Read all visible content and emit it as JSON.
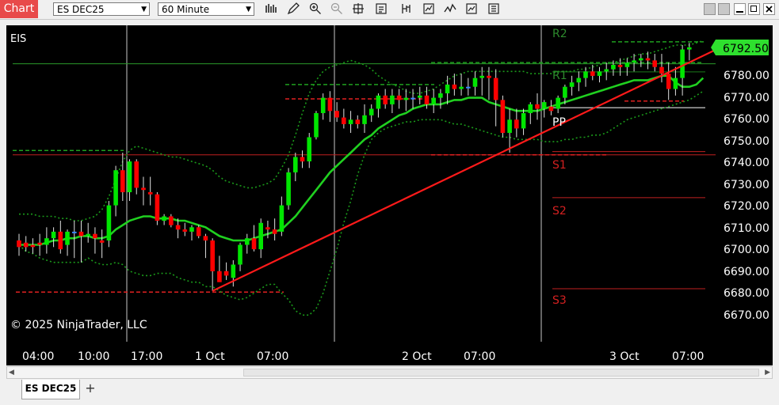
{
  "toolbar": {
    "chart_label": "Chart",
    "instrument": "ES DEC25",
    "interval": "60 Minute",
    "icons": [
      "bars-icon",
      "pencil-icon",
      "zoom-in-icon",
      "zoom-out-icon",
      "crosshair-icon",
      "properties-icon",
      "data-box-icon",
      "strategies-icon",
      "indicators-icon",
      "templates-icon",
      "share-icon"
    ]
  },
  "chart": {
    "symbol": "EIS",
    "copyright": "© 2025 NinjaTrader, LLC",
    "last_price_label": "6792.50",
    "colors": {
      "background": "#000000",
      "up": "#00e600",
      "down": "#ff0000",
      "doji": "#3a86ff",
      "ema": "#20d020",
      "bands": "#1a9a1a",
      "trendline": "#ff1a1a",
      "grid": "#c8c8c8"
    },
    "pivot_labels": {
      "r2": "R2",
      "r1": "R1",
      "pp": "PP",
      "s1": "S1",
      "s2": "S2",
      "s3": "S3"
    },
    "x_ticks": [
      "04:00",
      "10:00",
      "17:00",
      "1 Oct",
      "07:00",
      "2 Oct",
      "07:00",
      "3 Oct",
      "07:00"
    ],
    "y_ticks": [
      "6780.00",
      "6770.00",
      "6760.00",
      "6750.00",
      "6740.00",
      "6730.00",
      "6720.00",
      "6710.00",
      "6700.00",
      "6690.00",
      "6680.00",
      "6670.00"
    ]
  },
  "chart_data": {
    "type": "candlestick",
    "ylim": [
      6664,
      6802
    ],
    "y_ticks": [
      6780,
      6770,
      6760,
      6750,
      6740,
      6730,
      6720,
      6710,
      6700,
      6690,
      6680,
      6670
    ],
    "candles": [
      [
        6704,
        6707,
        6697,
        6701
      ],
      [
        6703,
        6706,
        6699,
        6701
      ],
      [
        6702,
        6705,
        6698,
        6701
      ],
      [
        6703,
        6707,
        6697,
        6702
      ],
      [
        6702,
        6710,
        6698,
        6705
      ],
      [
        6705,
        6710,
        6701,
        6708
      ],
      [
        6708,
        6713,
        6698,
        6700
      ],
      [
        6702,
        6709,
        6697,
        6708
      ],
      [
        6708,
        6713,
        6696,
        6708
      ],
      [
        6708,
        6713,
        6694,
        6706
      ],
      [
        6706,
        6712,
        6703,
        6707
      ],
      [
        6707,
        6710,
        6698,
        6705
      ],
      [
        6704,
        6709,
        6696,
        6703
      ],
      [
        6704,
        6722,
        6701,
        6720
      ],
      [
        6720,
        6738,
        6715,
        6736
      ],
      [
        6736,
        6744,
        6722,
        6726
      ],
      [
        6726,
        6741,
        6722,
        6740
      ],
      [
        6740,
        6741,
        6725,
        6728
      ],
      [
        6728,
        6733,
        6720,
        6727
      ],
      [
        6726,
        6733,
        6720,
        6725
      ],
      [
        6725,
        6726,
        6711,
        6713
      ],
      [
        6713,
        6716,
        6711,
        6715
      ],
      [
        6715,
        6716,
        6710,
        6711
      ],
      [
        6711,
        6714,
        6705,
        6709
      ],
      [
        6709,
        6712,
        6706,
        6708
      ],
      [
        6708,
        6711,
        6704,
        6710
      ],
      [
        6710,
        6711,
        6705,
        6706
      ],
      [
        6706,
        6707,
        6696,
        6704
      ],
      [
        6704,
        6705,
        6681,
        6690
      ],
      [
        6690,
        6697,
        6686,
        6685
      ],
      [
        6690,
        6694,
        6686,
        6688
      ],
      [
        6687,
        6695,
        6683,
        6693
      ],
      [
        6693,
        6703,
        6690,
        6702
      ],
      [
        6702,
        6707,
        6698,
        6705
      ],
      [
        6705,
        6711,
        6699,
        6700
      ],
      [
        6700,
        6714,
        6696,
        6712
      ],
      [
        6710,
        6713,
        6705,
        6709
      ],
      [
        6709,
        6714,
        6704,
        6707
      ],
      [
        6708,
        6724,
        6706,
        6720
      ],
      [
        6720,
        6737,
        6718,
        6735
      ],
      [
        6735,
        6744,
        6731,
        6742
      ],
      [
        6742,
        6745,
        6737,
        6740
      ],
      [
        6740,
        6753,
        6737,
        6751
      ],
      [
        6751,
        6763,
        6750,
        6762
      ],
      [
        6762,
        6771,
        6759,
        6769
      ],
      [
        6769,
        6772,
        6758,
        6763
      ],
      [
        6763,
        6767,
        6758,
        6760
      ],
      [
        6760,
        6764,
        6755,
        6757
      ],
      [
        6757,
        6763,
        6753,
        6759
      ],
      [
        6759,
        6761,
        6755,
        6757
      ],
      [
        6757,
        6766,
        6753,
        6761
      ],
      [
        6761,
        6766,
        6758,
        6764
      ],
      [
        6764,
        6771,
        6760,
        6770
      ],
      [
        6770,
        6773,
        6764,
        6766
      ],
      [
        6766,
        6773,
        6762,
        6770
      ],
      [
        6770,
        6773,
        6764,
        6768
      ],
      [
        6768,
        6773,
        6763,
        6769
      ],
      [
        6769,
        6773,
        6764,
        6769
      ],
      [
        6769,
        6774,
        6766,
        6770
      ],
      [
        6770,
        6774,
        6764,
        6766
      ],
      [
        6766,
        6773,
        6762,
        6769
      ],
      [
        6769,
        6773,
        6764,
        6771
      ],
      [
        6771,
        6779,
        6766,
        6775
      ],
      [
        6775,
        6780,
        6770,
        6773
      ],
      [
        6773,
        6780,
        6770,
        6774
      ],
      [
        6774,
        6778,
        6770,
        6774
      ],
      [
        6774,
        6781,
        6770,
        6778
      ],
      [
        6778,
        6783,
        6770,
        6779
      ],
      [
        6779,
        6783,
        6768,
        6778
      ],
      [
        6778,
        6782,
        6756,
        6768
      ],
      [
        6768,
        6770,
        6751,
        6753
      ],
      [
        6753,
        6764,
        6744,
        6759
      ],
      [
        6759,
        6764,
        6751,
        6755
      ],
      [
        6755,
        6764,
        6752,
        6762
      ],
      [
        6762,
        6767,
        6757,
        6766
      ],
      [
        6766,
        6771,
        6759,
        6764
      ],
      [
        6764,
        6768,
        6760,
        6767
      ],
      [
        6765,
        6768,
        6761,
        6763
      ],
      [
        6764,
        6770,
        6762,
        6769
      ],
      [
        6769,
        6775,
        6766,
        6774
      ],
      [
        6774,
        6779,
        6770,
        6776
      ],
      [
        6776,
        6781,
        6772,
        6778
      ],
      [
        6778,
        6783,
        6774,
        6781
      ],
      [
        6781,
        6784,
        6777,
        6779
      ],
      [
        6779,
        6783,
        6776,
        6781
      ],
      [
        6781,
        6785,
        6777,
        6782
      ],
      [
        6782,
        6786,
        6779,
        6784
      ],
      [
        6784,
        6787,
        6779,
        6783
      ],
      [
        6783,
        6787,
        6779,
        6785
      ],
      [
        6785,
        6789,
        6781,
        6786
      ],
      [
        6786,
        6789,
        6783,
        6787
      ],
      [
        6787,
        6790,
        6782,
        6786
      ],
      [
        6786,
        6789,
        6781,
        6783
      ],
      [
        6783,
        6789,
        6776,
        6780
      ],
      [
        6780,
        6785,
        6768,
        6773
      ],
      [
        6773,
        6783,
        6770,
        6778
      ],
      [
        6778,
        6793,
        6770,
        6791
      ],
      [
        6791,
        6794,
        6786,
        6792
      ]
    ],
    "ema": [
      6702,
      6702,
      6702,
      6702,
      6703,
      6704,
      6704,
      6705,
      6705,
      6706,
      6706,
      6705,
      6705,
      6706,
      6709,
      6711,
      6713,
      6714,
      6715,
      6715,
      6714,
      6714,
      6714,
      6713,
      6713,
      6712,
      6711,
      6710,
      6708,
      6706,
      6705,
      6704,
      6704,
      6704,
      6705,
      6706,
      6707,
      6708,
      6709,
      6712,
      6715,
      6719,
      6723,
      6727,
      6731,
      6735,
      6738,
      6741,
      6744,
      6747,
      6750,
      6752,
      6755,
      6757,
      6759,
      6761,
      6762,
      6764,
      6765,
      6766,
      6766,
      6766,
      6767,
      6768,
      6768,
      6769,
      6769,
      6769,
      6767,
      6766,
      6765,
      6764,
      6763,
      6763,
      6763,
      6763,
      6764,
      6765,
      6766,
      6767,
      6768,
      6769,
      6770,
      6771,
      6772,
      6773,
      6774,
      6775,
      6776,
      6777,
      6777,
      6777,
      6778,
      6779,
      6779,
      6776,
      6774,
      6774,
      6775,
      6778
    ],
    "upper_band": [
      6716,
      6716,
      6716,
      6715,
      6715,
      6715,
      6714,
      6714,
      6713,
      6713,
      6714,
      6715,
      6718,
      6724,
      6732,
      6740,
      6745,
      6747,
      6746,
      6745,
      6744,
      6743,
      6742,
      6742,
      6741,
      6740,
      6739,
      6738,
      6736,
      6733,
      6731,
      6730,
      6729,
      6728,
      6728,
      6729,
      6730,
      6732,
      6737,
      6743,
      6752,
      6762,
      6771,
      6777,
      6781,
      6783,
      6784,
      6785,
      6786,
      6785,
      6784,
      6782,
      6779,
      6777,
      6775,
      6774,
      6772,
      6771,
      6771,
      6772,
      6773,
      6775,
      6777,
      6779,
      6780,
      6781,
      6781,
      6781,
      6781,
      6781,
      6781,
      6781,
      6781,
      6781,
      6780,
      6780,
      6780,
      6780,
      6781,
      6781,
      6781,
      6782,
      6782,
      6783,
      6784,
      6785,
      6785,
      6786,
      6787,
      6788,
      6789,
      6789,
      6790,
      6791,
      6792,
      6793,
      6793,
      6793,
      6794,
      6795
    ],
    "lower_band": [
      6702,
      6699,
      6698,
      6696,
      6695,
      6694,
      6694,
      6694,
      6694,
      6694,
      6696,
      6694,
      6693,
      6693,
      6694,
      6693,
      6690,
      6689,
      6688,
      6688,
      6689,
      6689,
      6689,
      6687,
      6686,
      6685,
      6685,
      6683,
      6683,
      6681,
      6679,
      6678,
      6677,
      6678,
      6680,
      6682,
      6684,
      6684,
      6680,
      6677,
      6672,
      6670,
      6670,
      6673,
      6680,
      6690,
      6700,
      6712,
      6722,
      6734,
      6743,
      6750,
      6753,
      6755,
      6756,
      6757,
      6758,
      6758,
      6759,
      6759,
      6759,
      6759,
      6758,
      6757,
      6757,
      6756,
      6755,
      6754,
      6753,
      6752,
      6751,
      6751,
      6750,
      6750,
      6750,
      6750,
      6749,
      6749,
      6749,
      6750,
      6750,
      6751,
      6751,
      6752,
      6752,
      6753,
      6755,
      6757,
      6759,
      6760,
      6761,
      6762,
      6763,
      6764,
      6765,
      6766,
      6767,
      6768,
      6770,
      6772
    ],
    "pivots": {
      "r2": 6794.5,
      "r1": 6780.8,
      "pp": 6764.5,
      "s1": 6744.5,
      "s2": 6723.5,
      "s3": 6682.0
    },
    "prior_levels": [
      {
        "value": 6775,
        "from": 6,
        "to": 7
      },
      {
        "value": 6743,
        "from": 0,
        "to": 2
      },
      {
        "value": 6680.5,
        "from": 0,
        "to": 4
      }
    ],
    "trendline": [
      {
        "bar": 28,
        "price": 6681
      },
      {
        "bar": 99,
        "price": 6790
      }
    ],
    "support_line": {
      "from_bar": 55,
      "to_bar": 100,
      "price": 6743
    }
  }
}
